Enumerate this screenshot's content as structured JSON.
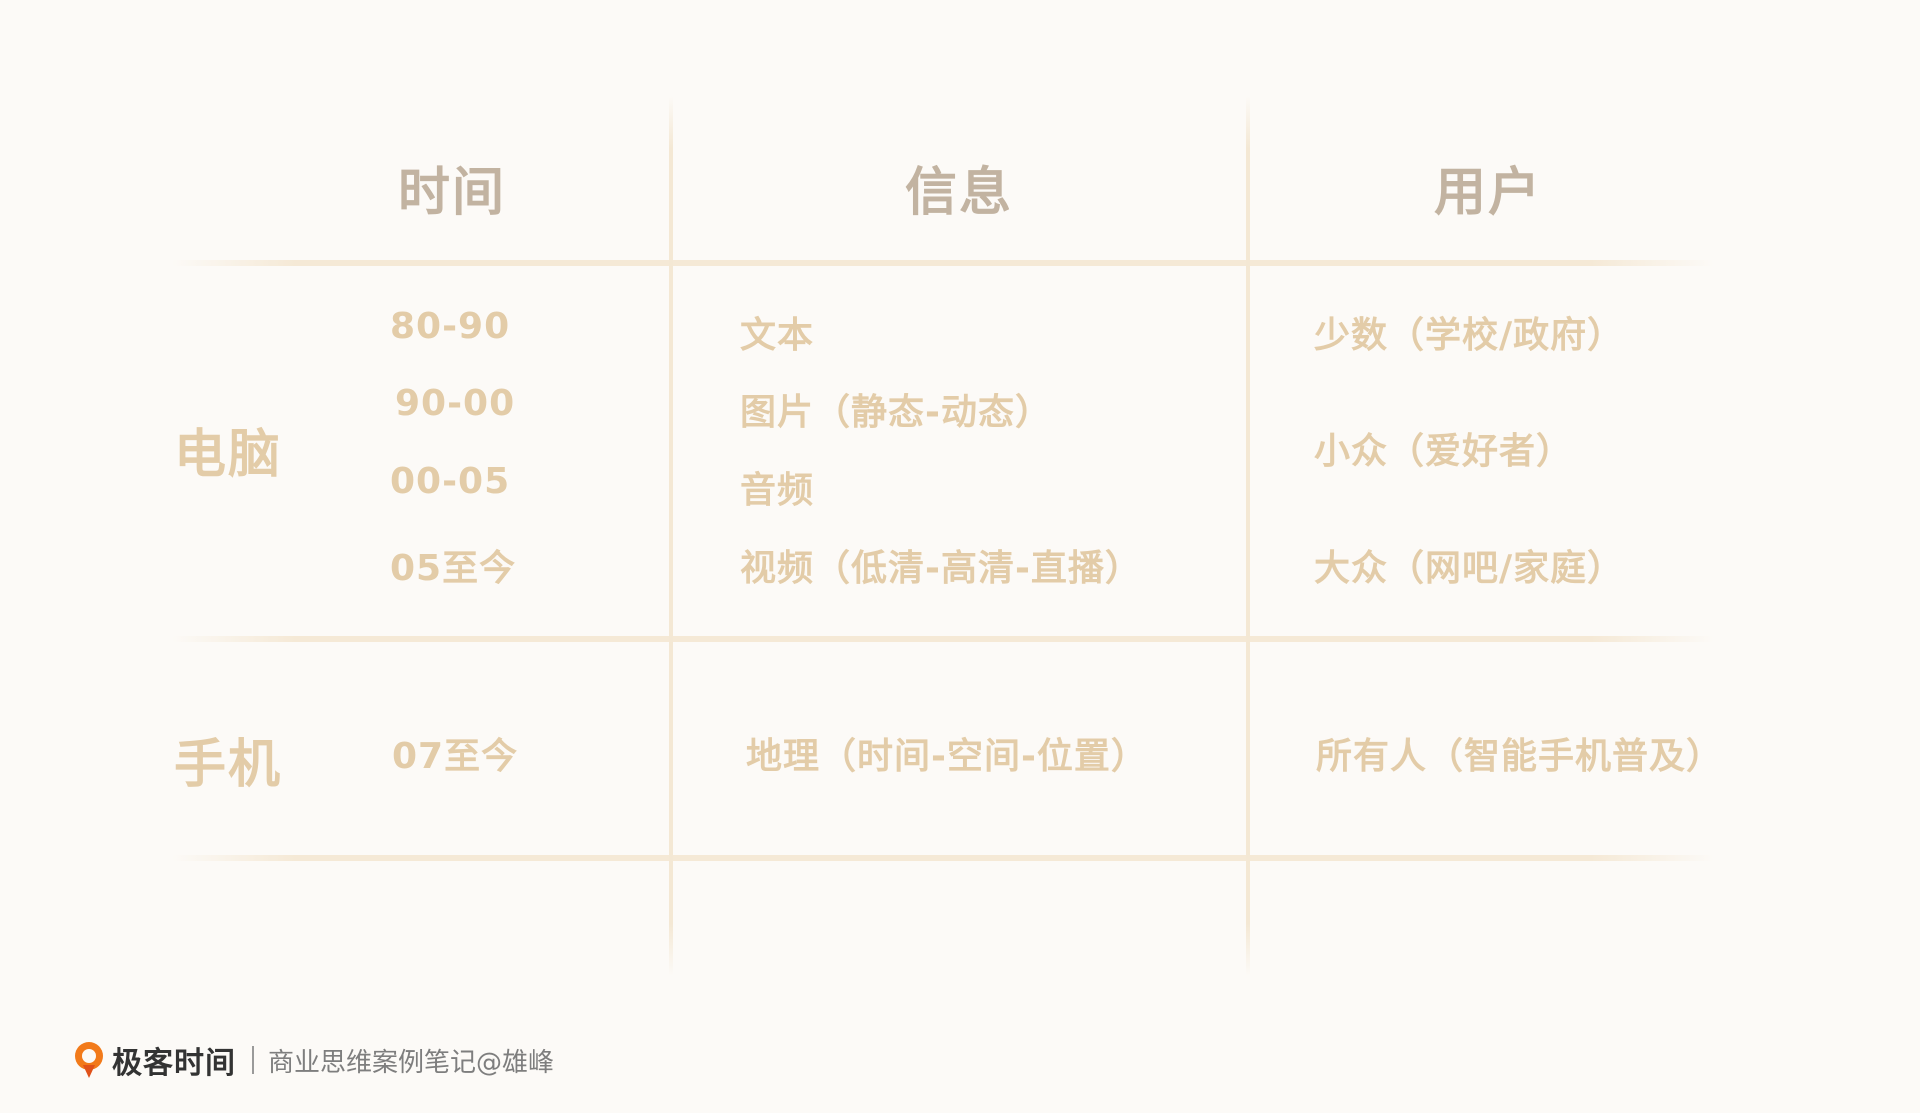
{
  "table": {
    "headers": [
      "时间",
      "信息",
      "用户"
    ],
    "rows": [
      {
        "label": "电脑",
        "time": [
          "80-90",
          "90-00",
          "00-05",
          "05至今"
        ],
        "info": [
          "文本",
          "图片（静态-动态）",
          "音频",
          "视频（低清-高清-直播）"
        ],
        "user": [
          "少数（学校/政府）",
          "小众（爱好者）",
          "大众（网吧/家庭）"
        ]
      },
      {
        "label": "手机",
        "time": [
          "07至今"
        ],
        "info": [
          "地理（时间-空间-位置）"
        ],
        "user": [
          "所有人（智能手机普及）"
        ]
      }
    ]
  },
  "footer": {
    "logo_icon": "geektime-logo-icon",
    "brand": "极客时间",
    "tagline": "商业思维案例笔记@雄峰"
  },
  "colors": {
    "background": "#fcfaf7",
    "header_text": "#c2b3a1",
    "cell_text": "#e3cca8",
    "grid_line": "#f5e9d6",
    "logo_orange": "#f27a1a"
  }
}
